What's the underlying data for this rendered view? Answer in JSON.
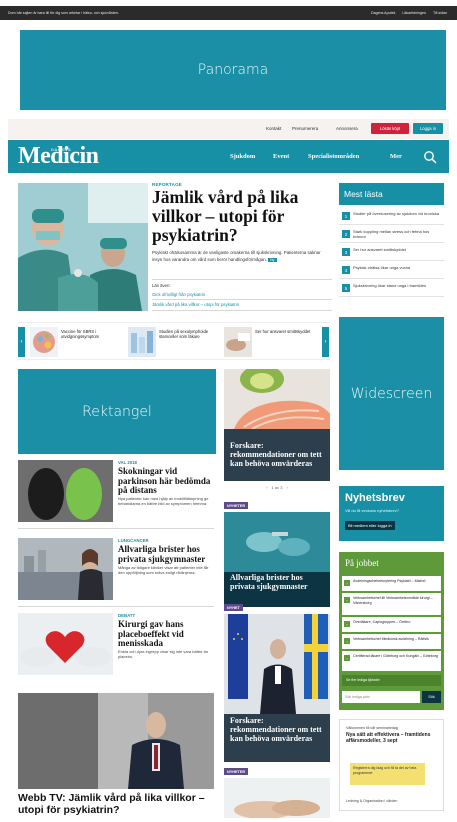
{
  "top_strip": {
    "left_text": "Dom här sajten är bara till för dig som arbetar i hälso- och sjukvården.",
    "links": [
      "Dagens Apotek",
      "Läkartidningen",
      "Till sidan"
    ]
  },
  "ads": {
    "panorama": "Panorama",
    "rektangel": "Rektangel",
    "widescreen": "Widescreen"
  },
  "utility_bar": {
    "links": [
      "Kontakt",
      "Prenumerera",
      "Annonsera"
    ],
    "buy_button": "Lösäs köpt",
    "login_button": "Logga in"
  },
  "nav": {
    "logo_small": "DAGENS",
    "logo": "Medicin",
    "items": [
      "Sjukdom",
      "Event",
      "Specialistområden",
      "Mer"
    ]
  },
  "hero": {
    "kicker": "REPORTAGE",
    "title": "Jämlik vård på lika villkor – utopi för psykiatrin?",
    "ingress": "Psykiskt ohälsosamma är de vanligaste orsakerna till sjukskrivning. Patienterna saknar insyn hos varandra om vård som berör handlingsförmågan.",
    "badge": "Ny",
    "related_label": "Läs även:",
    "related": [
      "Gick ofrivilligt från psykiatrin",
      "Jämlik vård på lika villkor – utopi för psykiatrin"
    ]
  },
  "carousel": [
    "Vaccine för SBRS i utvidgningssymptom",
    "Studien på sexolymphoide stamceller som läkare",
    "Ser hur ansvaret smittskyddet"
  ],
  "mest_lasta": {
    "title": "Mest lästa",
    "items": [
      "Studier på överdosering av sjukdom vid kroniska",
      "Stark koppling mellan stress och fetma hos kvinnor",
      "Ser hur ansvaret smittskyddet",
      "Psykisk ohälsa ökar unga vuxna",
      "Sjukskrivning ökar bland unga i framtiden"
    ]
  },
  "articles_left": [
    {
      "kicker": "VAL 2018",
      "title": "Skokningar vid parkinson här bedömda på distans",
      "text": "Nya patienter kan med hjälp av mobiltillämpning ge behandlarna en bättre bild av symptomen hemma."
    },
    {
      "kicker": "LUNGCANCER",
      "title": "Allvarliga brister hos privata sjukgymnaster",
      "text": "Många av tidigare kliniker visar att patienter inte får den uppföljning som krävs enligt riktlinjerna."
    },
    {
      "kicker": "DEBATT",
      "title": "Kirurgi gav hans placeboeffekt vid menisskada",
      "text": "Enkla och dyra ingrepp visar sig inte vara bättre än placebo."
    }
  ],
  "middle_cards": {
    "card1": {
      "title": "Forskare: rekommendationer om tett kan behöva omvärderas",
      "pager": "1 av 3"
    },
    "card2": {
      "tag": "NYHETER",
      "title": "Allvarliga brister hos privata sjukgymnaster"
    },
    "card3": {
      "tag": "NYHET",
      "title": "Forskare: rekommendationer om tett kan behöva omvärderas"
    },
    "card4": {
      "tag": "NYHETER"
    }
  },
  "nyhetsbrev": {
    "title": "Nyhetsbrev",
    "description": "Vill du få veckans nyhetsbrev?",
    "button": "Bli medlem eller logga in"
  },
  "pa_jobbet": {
    "title": "På jobbet",
    "items": [
      "Avdelningschefsrekrytering Psykiatri – Malmö",
      "Verksamhetschef till Verksamhetsområde kirurgi – Vänersborg",
      "Överläkare, Capiogruppen – Örebro",
      "Verksamhetschef Medicinsk avdelning – Rättvik",
      "Certifierad läkare i Göteborg och Kungälv – Göteborg"
    ],
    "all_jobs": "Se fler lediga tjänster",
    "search_placeholder": "Sök lediga jobb",
    "search_button": "Sök"
  },
  "small_ad": {
    "line1": "Välkommen till vår seminariedag",
    "line2": "Nya sätt att effektivera – framtidens affärsmodeller, 3 sept",
    "highlight": "Registrera dig idag och få ta del av hela programmet",
    "footer": "Ledning & Organisation i vården"
  },
  "webb_tv": {
    "title": "Webb TV: Jämlik vård på lika villkor – utopi för psykiatrin?"
  },
  "colors": {
    "brand": "#1790a6",
    "ad_placeholder": "#1a8fa6",
    "buy_button": "#d0233b",
    "jobs_green": "#5e9a3a",
    "tag_purple": "#5c4a8a"
  }
}
